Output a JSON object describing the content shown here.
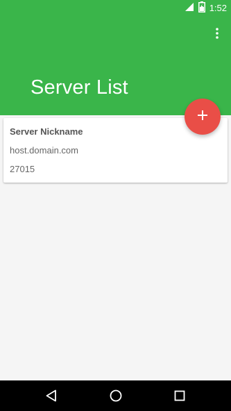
{
  "status_bar": {
    "time": "1:52",
    "icons": [
      "signal-icon",
      "battery-icon"
    ]
  },
  "header": {
    "title": "Server List",
    "menu_icon": "more-vert-icon",
    "color": "#3ab54a"
  },
  "fab": {
    "icon": "add-icon",
    "color": "#e94e47"
  },
  "servers": [
    {
      "nickname": "Server Nickname",
      "host": "host.domain.com",
      "port": "27015"
    }
  ],
  "nav_bar": {
    "buttons": [
      "back-icon",
      "home-icon",
      "recents-icon"
    ]
  }
}
